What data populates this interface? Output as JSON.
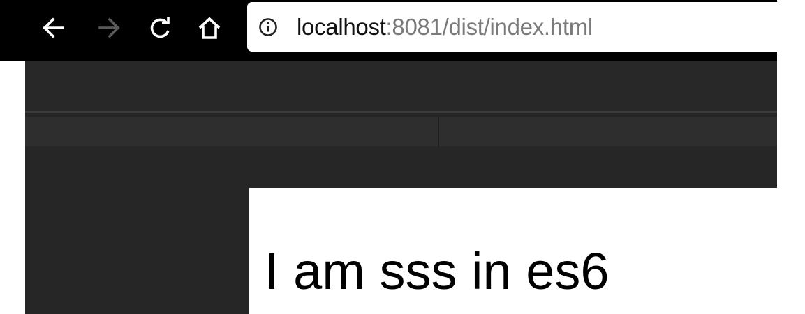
{
  "browser": {
    "address_bar": {
      "host": "localhost",
      "path": ":8081/dist/index.html"
    },
    "icons": {
      "back": "back-arrow-icon",
      "forward": "forward-arrow-icon",
      "reload": "reload-icon",
      "home": "home-icon",
      "site_info": "info-icon"
    },
    "forward_enabled": false
  },
  "page": {
    "heading": "I am sss in es6"
  },
  "colors": {
    "toolbar": "#000000",
    "devtools_background": "#262626",
    "url_host": "#111111",
    "url_path": "#7a7a7a"
  }
}
